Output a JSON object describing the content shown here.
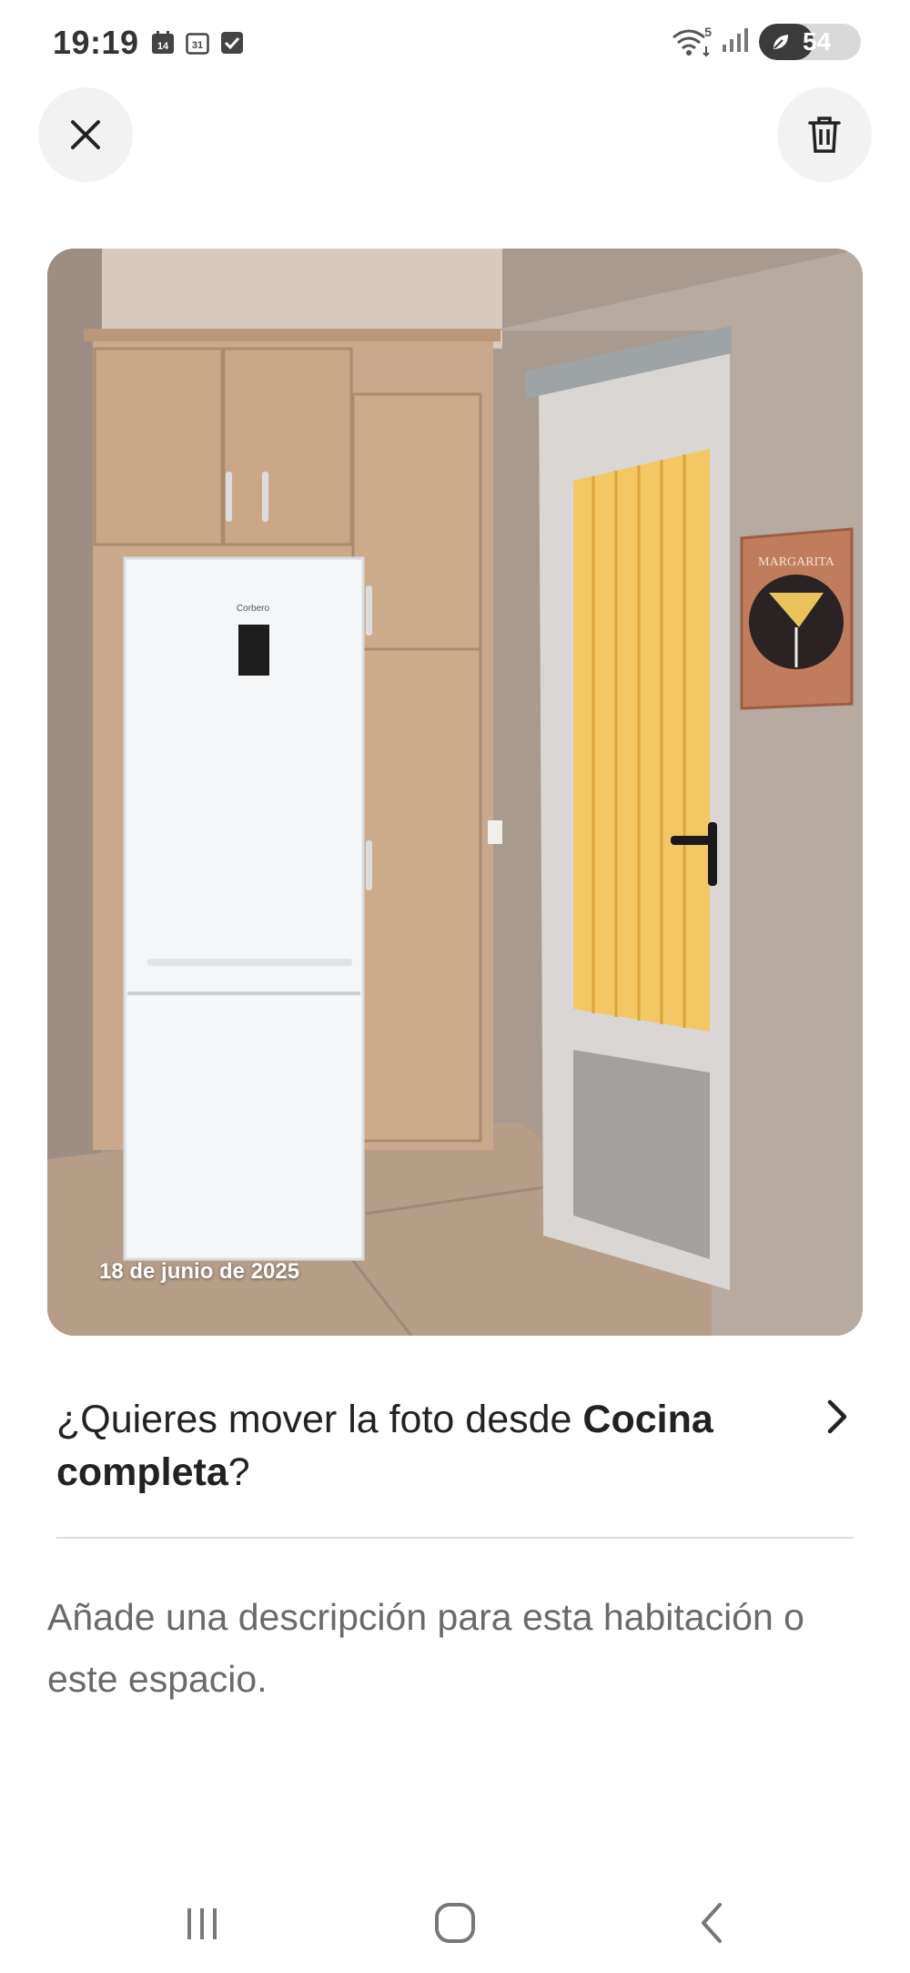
{
  "status_bar": {
    "time": "19:19",
    "left_icons": [
      "calendar-14-icon",
      "calendar-31-icon",
      "checkbox-icon"
    ],
    "calendar_day_a": "14",
    "calendar_day_b": "31",
    "right_icons": [
      "wifi-icon",
      "signal-icon",
      "battery-icon"
    ],
    "wifi_label": "5",
    "battery_level": "54",
    "battery_fraction": 0.54
  },
  "toolbar": {
    "close_icon": "close-icon",
    "delete_icon": "trash-icon"
  },
  "photo": {
    "date": "18 de junio de 2025",
    "fridge_brand": "Corbero",
    "poster_title": "MARGARITA"
  },
  "move_prompt": {
    "prefix": "¿Quieres mover la foto desde ",
    "room_name": "Cocina completa",
    "suffix": "?"
  },
  "description": {
    "placeholder": "Añade una descripción para esta habitación o este espacio."
  },
  "nav_bar": {
    "items": [
      "recent-apps-icon",
      "home-icon",
      "back-icon"
    ]
  },
  "colors": {
    "accent_text": "#222222",
    "muted_text": "#6a6a6a",
    "button_bg": "#f2f2f2"
  }
}
